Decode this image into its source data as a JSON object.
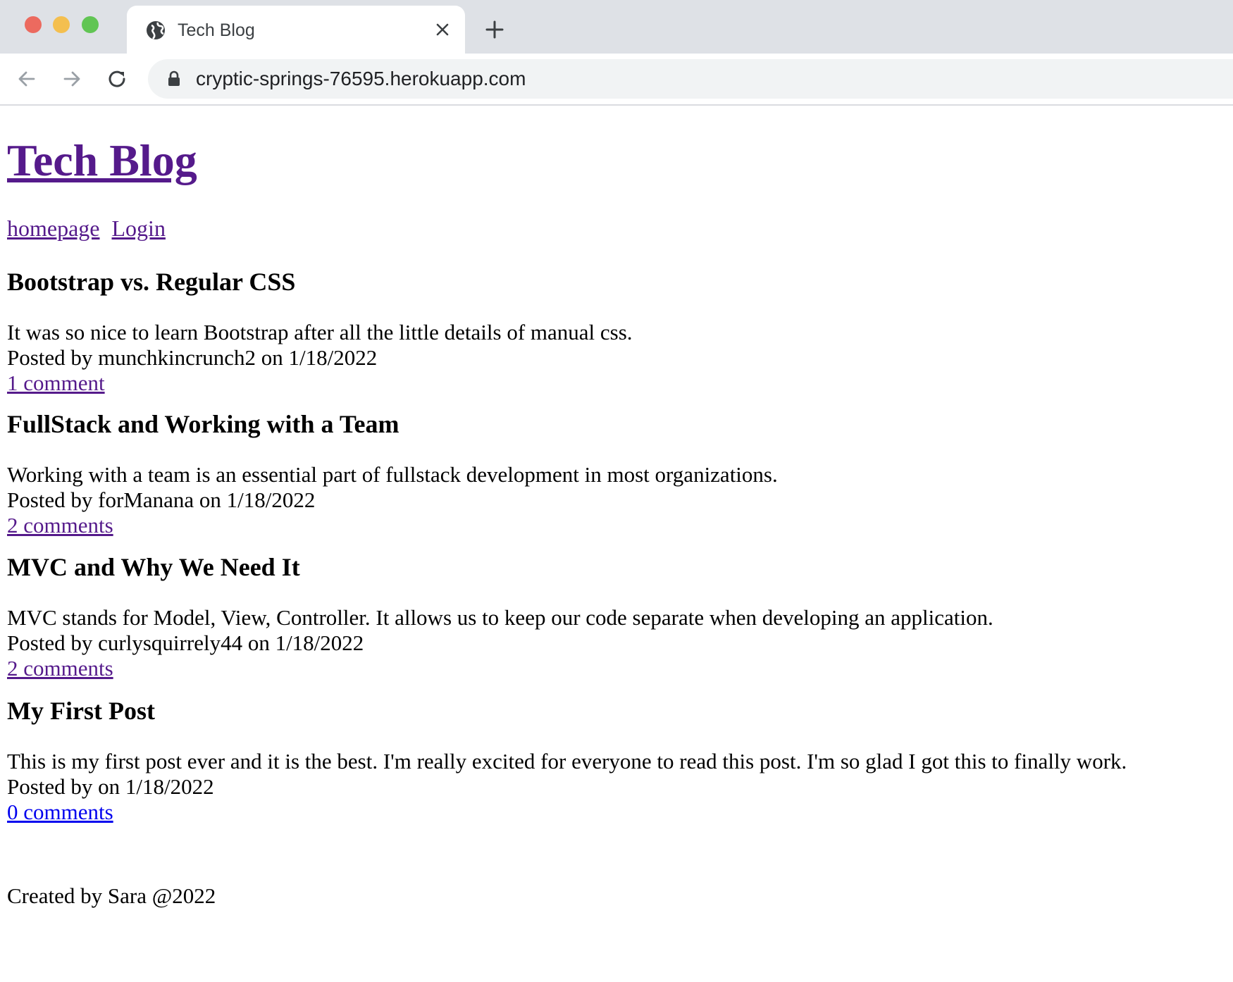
{
  "browser": {
    "tab_title": "Tech Blog",
    "url": "cryptic-springs-76595.herokuapp.com"
  },
  "site": {
    "title": "Tech Blog",
    "nav": [
      {
        "label": "homepage"
      },
      {
        "label": "Login"
      }
    ]
  },
  "posts": [
    {
      "title": "Bootstrap vs. Regular CSS",
      "body": "It was so nice to learn Bootstrap after all the little details of manual css.",
      "meta": "Posted by munchkincrunch2 on 1/18/2022",
      "comments": "1 comment"
    },
    {
      "title": "FullStack and Working with a Team",
      "body": "Working with a team is an essential part of fullstack development in most organizations.",
      "meta": "Posted by forManana on 1/18/2022",
      "comments": "2 comments"
    },
    {
      "title": "MVC and Why We Need It",
      "body": "MVC stands for Model, View, Controller. It allows us to keep our code separate when developing an application.",
      "meta": "Posted by curlysquirrely44 on 1/18/2022",
      "comments": "2 comments"
    },
    {
      "title": "My First Post",
      "body": "This is my first post ever and it is the best. I'm really excited for everyone to read this post. I'm so glad I got this to finally work.",
      "meta": "Posted by on 1/18/2022",
      "comments": "0 comments"
    }
  ],
  "footer": {
    "text": "Created by Sara @2022"
  },
  "colors": {
    "visited_link": "#551a8b",
    "unvisited_link": "#0000ee",
    "tab_strip": "#dee1e6",
    "omnibox": "#f1f3f4"
  },
  "icons": {
    "tab": "globe-icon",
    "close": "close-icon",
    "new_tab": "plus-icon",
    "back": "arrow-left-icon",
    "forward": "arrow-right-icon",
    "reload": "reload-icon",
    "secure": "lock-icon"
  }
}
